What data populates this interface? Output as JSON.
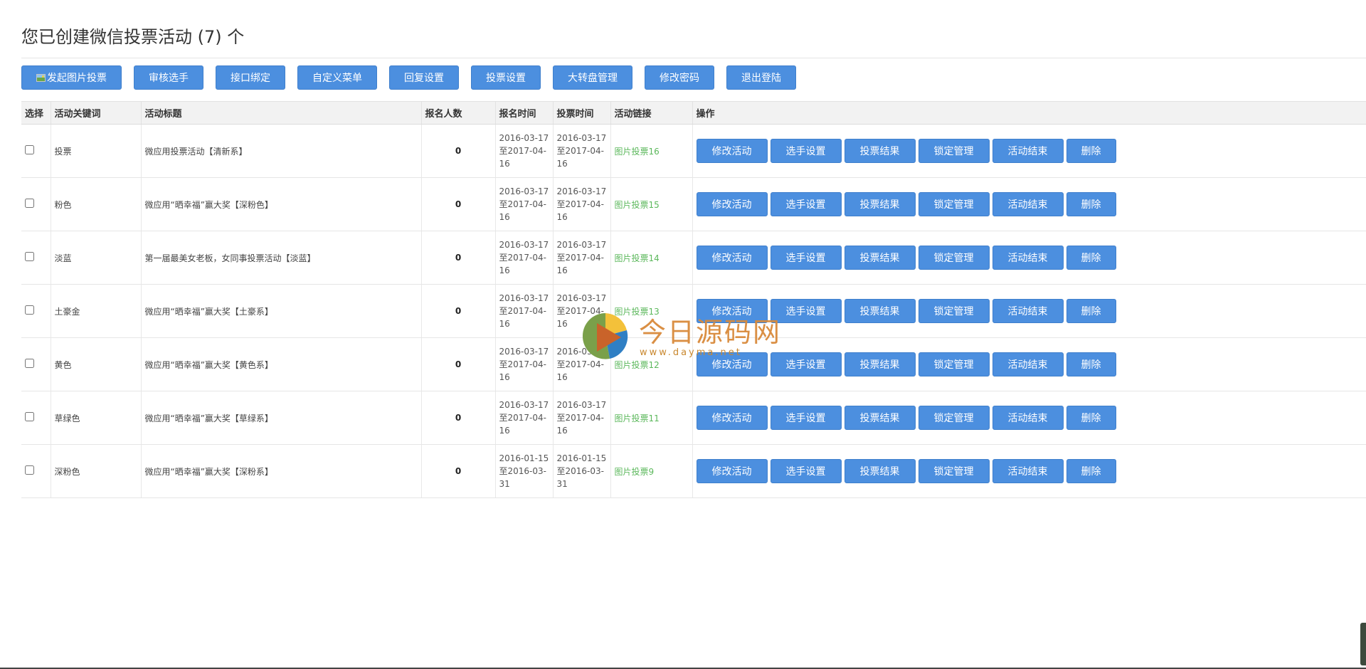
{
  "page": {
    "title": "您已创建微信投票活动 (7) 个"
  },
  "toolbar": {
    "create_label": "发起图片投票",
    "review_label": "审核选手",
    "api_label": "接口绑定",
    "menu_label": "自定义菜单",
    "reply_label": "回复设置",
    "vote_settings_label": "投票设置",
    "wheel_label": "大转盘管理",
    "password_label": "修改密码",
    "logout_label": "退出登陆"
  },
  "table": {
    "headers": {
      "select": "选择",
      "keyword": "活动关键词",
      "title": "活动标题",
      "count": "报名人数",
      "signup_time": "报名时间",
      "vote_time": "投票时间",
      "link": "活动链接",
      "actions": "操作"
    },
    "rows": [
      {
        "keyword": "投票",
        "title": "微应用投票活动【清新系】",
        "count": "0",
        "signup": "2016-03-17至2017-04-16",
        "vote": "2016-03-17至2017-04-16",
        "link": "图片投票16"
      },
      {
        "keyword": "粉色",
        "title": "微应用“晒幸福”赢大奖【深粉色】",
        "count": "0",
        "signup": "2016-03-17至2017-04-16",
        "vote": "2016-03-17至2017-04-16",
        "link": "图片投票15"
      },
      {
        "keyword": "淡蓝",
        "title": "第一届最美女老板，女同事投票活动【淡蓝】",
        "count": "0",
        "signup": "2016-03-17至2017-04-16",
        "vote": "2016-03-17至2017-04-16",
        "link": "图片投票14"
      },
      {
        "keyword": "土豪金",
        "title": "微应用“晒幸福”赢大奖【土豪系】",
        "count": "0",
        "signup": "2016-03-17至2017-04-16",
        "vote": "2016-03-17至2017-04-16",
        "link": "图片投票13"
      },
      {
        "keyword": "黄色",
        "title": "微应用“晒幸福”赢大奖【黄色系】",
        "count": "0",
        "signup": "2016-03-17至2017-04-16",
        "vote": "2016-03-17至2017-04-16",
        "link": "图片投票12"
      },
      {
        "keyword": "草绿色",
        "title": "微应用“晒幸福”赢大奖【草绿系】",
        "count": "0",
        "signup": "2016-03-17至2017-04-16",
        "vote": "2016-03-17至2017-04-16",
        "link": "图片投票11"
      },
      {
        "keyword": "深粉色",
        "title": "微应用“晒幸福”赢大奖【深粉系】",
        "count": "0",
        "signup": "2016-01-15至2016-03-31",
        "vote": "2016-01-15至2016-03-31",
        "link": "图片投票9"
      }
    ]
  },
  "row_actions": {
    "edit": "修改活动",
    "players": "选手设置",
    "results": "投票结果",
    "lock": "锁定管理",
    "end": "活动结束",
    "delete": "删除"
  },
  "watermark": {
    "text": "今日源码网",
    "url": "www.dayma.net"
  },
  "colors": {
    "button_bg": "#4c8fdf",
    "link": "#5cb85c",
    "header_bg": "#f2f2f2"
  }
}
